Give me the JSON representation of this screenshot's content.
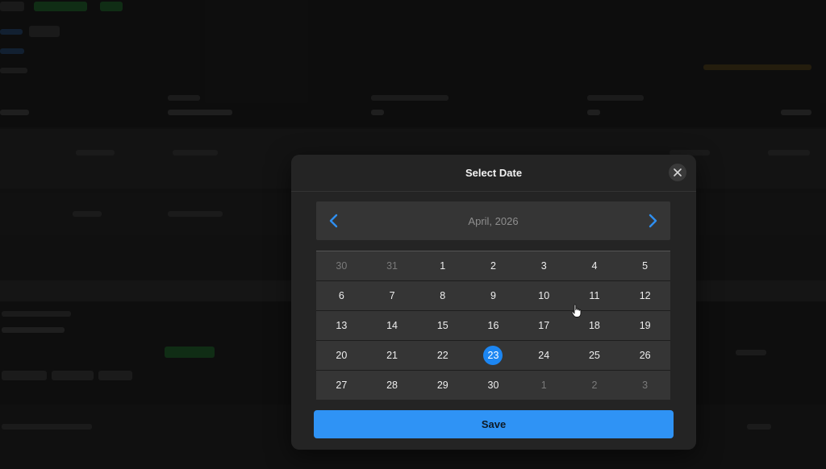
{
  "modal": {
    "title": "Select Date",
    "save_label": "Save"
  },
  "calendar": {
    "month_label": "April, 2026",
    "selected_day": "23",
    "weeks": [
      [
        {
          "d": "30",
          "m": true
        },
        {
          "d": "31",
          "m": true
        },
        {
          "d": "1"
        },
        {
          "d": "2"
        },
        {
          "d": "3"
        },
        {
          "d": "4"
        },
        {
          "d": "5"
        }
      ],
      [
        {
          "d": "6"
        },
        {
          "d": "7"
        },
        {
          "d": "8"
        },
        {
          "d": "9"
        },
        {
          "d": "10"
        },
        {
          "d": "11"
        },
        {
          "d": "12"
        }
      ],
      [
        {
          "d": "13"
        },
        {
          "d": "14"
        },
        {
          "d": "15"
        },
        {
          "d": "16"
        },
        {
          "d": "17"
        },
        {
          "d": "18"
        },
        {
          "d": "19"
        }
      ],
      [
        {
          "d": "20"
        },
        {
          "d": "21"
        },
        {
          "d": "22"
        },
        {
          "d": "23",
          "s": true
        },
        {
          "d": "24"
        },
        {
          "d": "25"
        },
        {
          "d": "26"
        }
      ],
      [
        {
          "d": "27"
        },
        {
          "d": "28"
        },
        {
          "d": "29"
        },
        {
          "d": "30"
        },
        {
          "d": "1",
          "m": true
        },
        {
          "d": "2",
          "m": true
        },
        {
          "d": "3",
          "m": true
        }
      ]
    ]
  },
  "colors": {
    "accent": "#1c86f2",
    "save_button": "#2f93f5",
    "nav_arrow": "#2f8ff0"
  },
  "icons": {
    "close": "close-icon",
    "prev": "chevron-left-icon",
    "next": "chevron-right-icon"
  }
}
